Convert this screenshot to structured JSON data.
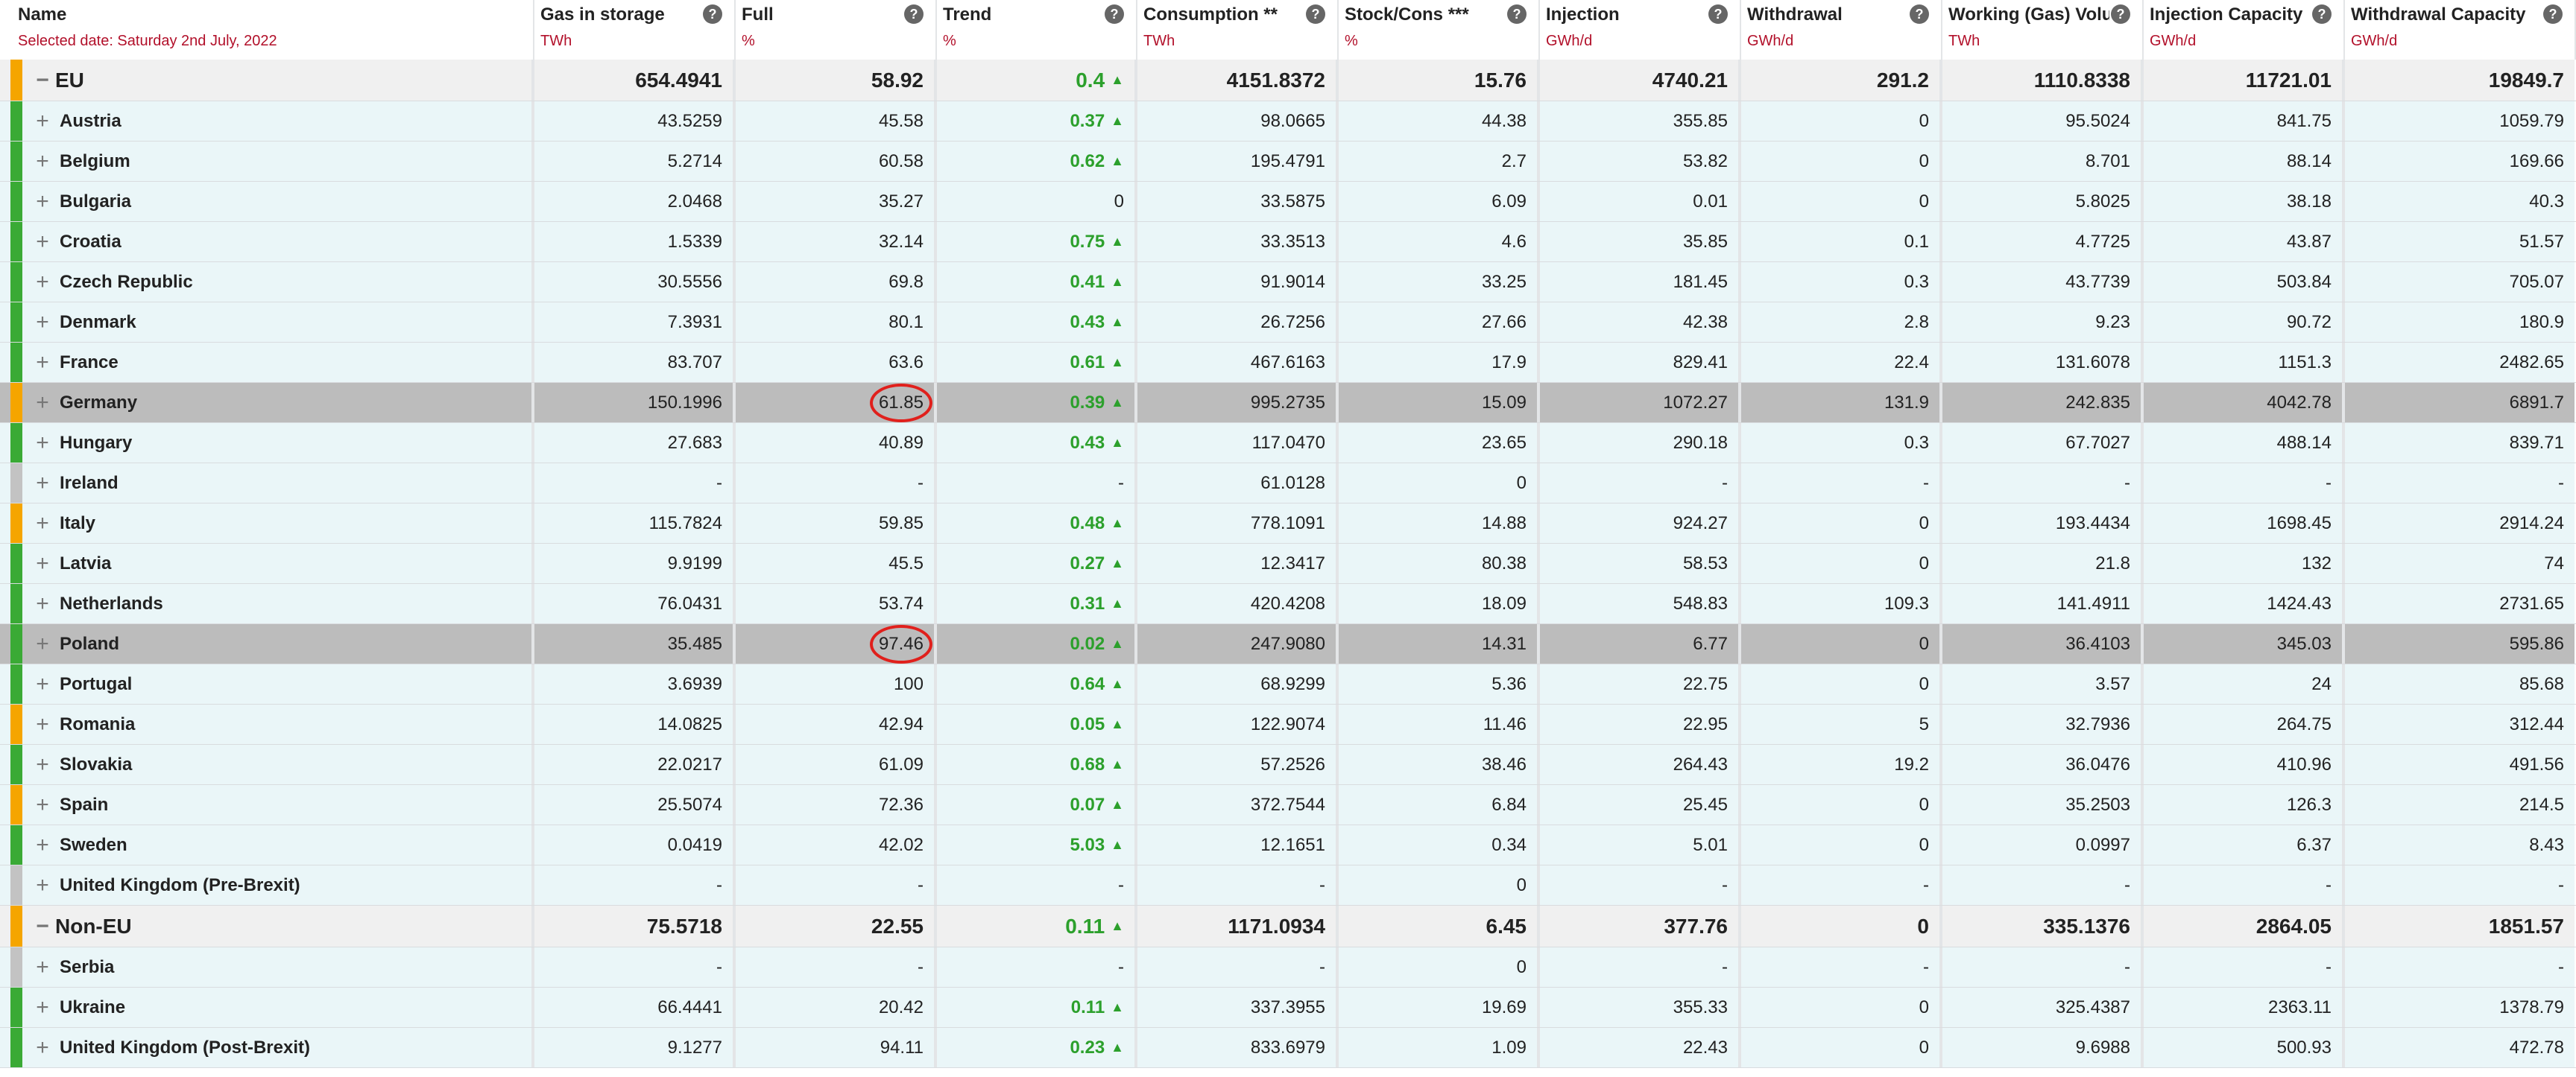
{
  "header": {
    "name_title": "Name",
    "selected_date": "Selected date: Saturday 2nd July, 2022",
    "columns": [
      {
        "title": "Gas in storage",
        "unit": "TWh"
      },
      {
        "title": "Full",
        "unit": "%"
      },
      {
        "title": "Trend",
        "unit": "%"
      },
      {
        "title": "Consumption **",
        "unit": "TWh"
      },
      {
        "title": "Stock/Cons ***",
        "unit": "%"
      },
      {
        "title": "Injection",
        "unit": "GWh/d"
      },
      {
        "title": "Withdrawal",
        "unit": "GWh/d"
      },
      {
        "title": "Working (Gas) Volume",
        "unit": "TWh"
      },
      {
        "title": "Injection Capacity",
        "unit": "GWh/d"
      },
      {
        "title": "Withdrawal Capacity",
        "unit": "GWh/d"
      }
    ],
    "help_glyph": "?"
  },
  "colors": {
    "green": "#3aaa35",
    "orange": "#f5a500",
    "grey": "#c3c3c3",
    "group_bg": "#f0f0f0",
    "row_bg": "#eaf6f8",
    "highlight_bg": "#bcbcbc",
    "trend_green": "#2ca02c",
    "circle_red": "#e0201c"
  },
  "symbols": {
    "collapse": "−",
    "expand": "+",
    "up": "▲"
  },
  "rows": [
    {
      "type": "group",
      "name": "EU",
      "status": "orange",
      "values": [
        "654.4941",
        "58.92",
        "0.4",
        "4151.8372",
        "15.76",
        "4740.21",
        "291.2",
        "1110.8338",
        "11721.01",
        "19849.7"
      ],
      "trend_up": true
    },
    {
      "type": "country",
      "name": "Austria",
      "status": "green",
      "values": [
        "43.5259",
        "45.58",
        "0.37",
        "98.0665",
        "44.38",
        "355.85",
        "0",
        "95.5024",
        "841.75",
        "1059.79"
      ],
      "trend_up": true
    },
    {
      "type": "country",
      "name": "Belgium",
      "status": "green",
      "values": [
        "5.2714",
        "60.58",
        "0.62",
        "195.4791",
        "2.7",
        "53.82",
        "0",
        "8.701",
        "88.14",
        "169.66"
      ],
      "trend_up": true
    },
    {
      "type": "country",
      "name": "Bulgaria",
      "status": "green",
      "values": [
        "2.0468",
        "35.27",
        "0",
        "33.5875",
        "6.09",
        "0.01",
        "0",
        "5.8025",
        "38.18",
        "40.3"
      ],
      "trend_up": false
    },
    {
      "type": "country",
      "name": "Croatia",
      "status": "green",
      "values": [
        "1.5339",
        "32.14",
        "0.75",
        "33.3513",
        "4.6",
        "35.85",
        "0.1",
        "4.7725",
        "43.87",
        "51.57"
      ],
      "trend_up": true
    },
    {
      "type": "country",
      "name": "Czech Republic",
      "status": "green",
      "values": [
        "30.5556",
        "69.8",
        "0.41",
        "91.9014",
        "33.25",
        "181.45",
        "0.3",
        "43.7739",
        "503.84",
        "705.07"
      ],
      "trend_up": true
    },
    {
      "type": "country",
      "name": "Denmark",
      "status": "green",
      "values": [
        "7.3931",
        "80.1",
        "0.43",
        "26.7256",
        "27.66",
        "42.38",
        "2.8",
        "9.23",
        "90.72",
        "180.9"
      ],
      "trend_up": true
    },
    {
      "type": "country",
      "name": "France",
      "status": "green",
      "values": [
        "83.707",
        "63.6",
        "0.61",
        "467.6163",
        "17.9",
        "829.41",
        "22.4",
        "131.6078",
        "1151.3",
        "2482.65"
      ],
      "trend_up": true
    },
    {
      "type": "country",
      "name": "Germany",
      "status": "orange",
      "highlight": true,
      "circled": true,
      "values": [
        "150.1996",
        "61.85",
        "0.39",
        "995.2735",
        "15.09",
        "1072.27",
        "131.9",
        "242.835",
        "4042.78",
        "6891.7"
      ],
      "trend_up": true
    },
    {
      "type": "country",
      "name": "Hungary",
      "status": "green",
      "values": [
        "27.683",
        "40.89",
        "0.43",
        "117.0470",
        "23.65",
        "290.18",
        "0.3",
        "67.7027",
        "488.14",
        "839.71"
      ],
      "trend_up": true
    },
    {
      "type": "country",
      "name": "Ireland",
      "status": "grey",
      "values": [
        "-",
        "-",
        "-",
        "61.0128",
        "0",
        "-",
        "-",
        "-",
        "-",
        "-"
      ],
      "trend_up": false
    },
    {
      "type": "country",
      "name": "Italy",
      "status": "orange",
      "values": [
        "115.7824",
        "59.85",
        "0.48",
        "778.1091",
        "14.88",
        "924.27",
        "0",
        "193.4434",
        "1698.45",
        "2914.24"
      ],
      "trend_up": true
    },
    {
      "type": "country",
      "name": "Latvia",
      "status": "green",
      "values": [
        "9.9199",
        "45.5",
        "0.27",
        "12.3417",
        "80.38",
        "58.53",
        "0",
        "21.8",
        "132",
        "74"
      ],
      "trend_up": true
    },
    {
      "type": "country",
      "name": "Netherlands",
      "status": "green",
      "values": [
        "76.0431",
        "53.74",
        "0.31",
        "420.4208",
        "18.09",
        "548.83",
        "109.3",
        "141.4911",
        "1424.43",
        "2731.65"
      ],
      "trend_up": true
    },
    {
      "type": "country",
      "name": "Poland",
      "status": "green",
      "highlight": true,
      "circled": true,
      "values": [
        "35.485",
        "97.46",
        "0.02",
        "247.9080",
        "14.31",
        "6.77",
        "0",
        "36.4103",
        "345.03",
        "595.86"
      ],
      "trend_up": true
    },
    {
      "type": "country",
      "name": "Portugal",
      "status": "green",
      "values": [
        "3.6939",
        "100",
        "0.64",
        "68.9299",
        "5.36",
        "22.75",
        "0",
        "3.57",
        "24",
        "85.68"
      ],
      "trend_up": true
    },
    {
      "type": "country",
      "name": "Romania",
      "status": "orange",
      "values": [
        "14.0825",
        "42.94",
        "0.05",
        "122.9074",
        "11.46",
        "22.95",
        "5",
        "32.7936",
        "264.75",
        "312.44"
      ],
      "trend_up": true
    },
    {
      "type": "country",
      "name": "Slovakia",
      "status": "green",
      "values": [
        "22.0217",
        "61.09",
        "0.68",
        "57.2526",
        "38.46",
        "264.43",
        "19.2",
        "36.0476",
        "410.96",
        "491.56"
      ],
      "trend_up": true
    },
    {
      "type": "country",
      "name": "Spain",
      "status": "orange",
      "values": [
        "25.5074",
        "72.36",
        "0.07",
        "372.7544",
        "6.84",
        "25.45",
        "0",
        "35.2503",
        "126.3",
        "214.5"
      ],
      "trend_up": true
    },
    {
      "type": "country",
      "name": "Sweden",
      "status": "green",
      "values": [
        "0.0419",
        "42.02",
        "5.03",
        "12.1651",
        "0.34",
        "5.01",
        "0",
        "0.0997",
        "6.37",
        "8.43"
      ],
      "trend_up": true
    },
    {
      "type": "country",
      "name": "United Kingdom (Pre-Brexit)",
      "status": "grey",
      "values": [
        "-",
        "-",
        "-",
        "-",
        "0",
        "-",
        "-",
        "-",
        "-",
        "-"
      ],
      "trend_up": false
    },
    {
      "type": "group",
      "name": "Non-EU",
      "status": "orange",
      "values": [
        "75.5718",
        "22.55",
        "0.11",
        "1171.0934",
        "6.45",
        "377.76",
        "0",
        "335.1376",
        "2864.05",
        "1851.57"
      ],
      "trend_up": true
    },
    {
      "type": "country",
      "name": "Serbia",
      "status": "grey",
      "values": [
        "-",
        "-",
        "-",
        "-",
        "0",
        "-",
        "-",
        "-",
        "-",
        "-"
      ],
      "trend_up": false
    },
    {
      "type": "country",
      "name": "Ukraine",
      "status": "green",
      "values": [
        "66.4441",
        "20.42",
        "0.11",
        "337.3955",
        "19.69",
        "355.33",
        "0",
        "325.4387",
        "2363.11",
        "1378.79"
      ],
      "trend_up": true
    },
    {
      "type": "country",
      "name": "United Kingdom (Post-Brexit)",
      "status": "green",
      "values": [
        "9.1277",
        "94.11",
        "0.23",
        "833.6979",
        "1.09",
        "22.43",
        "0",
        "9.6988",
        "500.93",
        "472.78"
      ],
      "trend_up": true
    }
  ]
}
